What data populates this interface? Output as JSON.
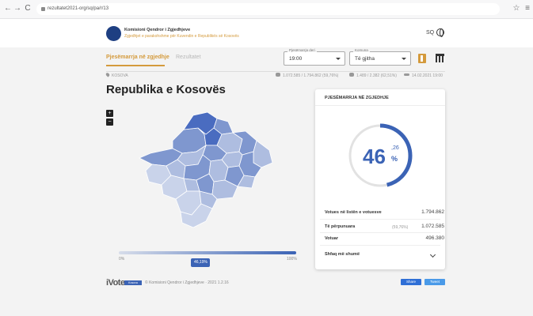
{
  "browser": {
    "url": "rezultatet2021-org/sq/pa/r/13"
  },
  "header": {
    "org_name": "Komisioni Qendror i Zgjedhjeve",
    "org_tagline": "Zgjedhjet e parakohshme për Kuvendin e Republikës së Kosovës",
    "lang": "SQ"
  },
  "tabs": [
    {
      "label": "Pjesëmarrja në zgjedhje",
      "active": true
    },
    {
      "label": "Rezultatet",
      "active": false
    }
  ],
  "filters": {
    "time": {
      "label": "Pjesëmarrja deri",
      "value": "19:00"
    },
    "municipality": {
      "label": "Komuna",
      "value": "Të gjitha"
    }
  },
  "breadcrumb": "KOSOVA",
  "stats": {
    "voters": "1.072.585 / 1.794.862 (59,76%)",
    "stations": "1.489 / 2.382 (62,51%)",
    "updated": "14.02.2021 19:00"
  },
  "region_title": "Republika e Kosovës",
  "zoom": {
    "in": "+",
    "out": "−"
  },
  "map_colors": {
    "dark": "#4a6cc0",
    "mid": "#7f97cf",
    "light": "#aebde0",
    "pale": "#c9d3ea"
  },
  "scale": {
    "min": "0%",
    "max": "100%",
    "marker": "46,19%",
    "marker_fraction": 0.4619
  },
  "card": {
    "title": "PJESËMARRJA NË ZGJEDHJE",
    "percent_int": "46",
    "percent_dec": ",26",
    "percent_sign": "%",
    "ring_fraction": 0.4626,
    "ring_color": "#3b63b5",
    "rows": [
      {
        "label": "Votues në listën e votuesve",
        "pct": "",
        "value": "1.794.862"
      },
      {
        "label": "Të përpunuara",
        "pct": "(59,76%)",
        "value": "1.072.585"
      },
      {
        "label": "Votuar",
        "pct": "",
        "value": "496.380"
      }
    ],
    "more_label": "Shfaq më shumë"
  },
  "footer": {
    "logo": "iVote",
    "badge": "Kosova",
    "copyright": "© Komisioni Qendror i Zgjedhjeve · 2021 1.2.16",
    "share": "Share",
    "tweet": "Tweet"
  }
}
